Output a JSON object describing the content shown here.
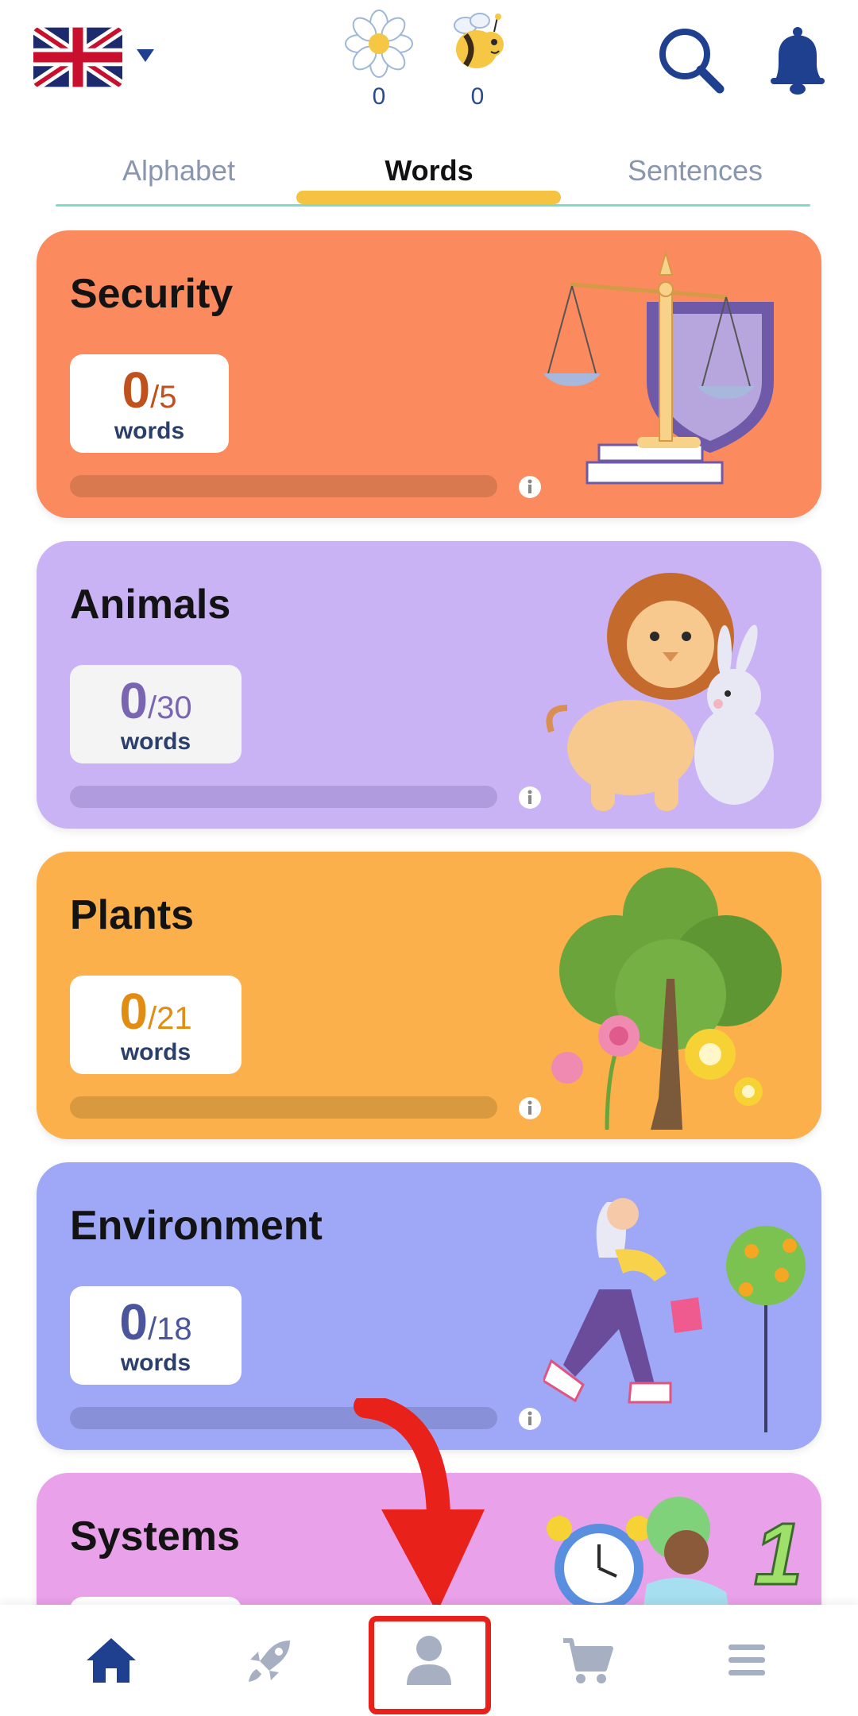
{
  "header": {
    "language_icon": "uk-flag-icon",
    "flower_count": "0",
    "bee_count": "0"
  },
  "tabs": [
    {
      "label": "Alphabet",
      "active": false
    },
    {
      "label": "Words",
      "active": true
    },
    {
      "label": "Sentences",
      "active": false
    }
  ],
  "cards": [
    {
      "title": "Security",
      "done": "0",
      "total": "/5",
      "unit": "words",
      "bg": "#fb8b5f",
      "box_bg": "#ffffff",
      "num_color": "#c0501c",
      "bar_color": "#d9794f",
      "progress": 0
    },
    {
      "title": "Animals",
      "done": "0",
      "total": "/30",
      "unit": "words",
      "bg": "#c9b3f4",
      "box_bg": "#f4f4f4",
      "num_color": "#7a65b3",
      "bar_color": "#b09bde",
      "progress": 0
    },
    {
      "title": "Plants",
      "done": "0",
      "total": "/21",
      "unit": "words",
      "bg": "#fbb04b",
      "box_bg": "#ffffff",
      "num_color": "#e18d14",
      "bar_color": "#d9993e",
      "progress": 0
    },
    {
      "title": "Environment",
      "done": "0",
      "total": "/18",
      "unit": "words",
      "bg": "#9ea8f6",
      "box_bg": "#ffffff",
      "num_color": "#4a559e",
      "bar_color": "#8891d8",
      "progress": 0
    },
    {
      "title": "Systems",
      "done": "",
      "total": "",
      "unit": "",
      "bg": "#e9a1e9",
      "box_bg": "#ffffff",
      "num_color": "#9b4a9b",
      "bar_color": "#cf87cf",
      "progress": 0
    }
  ],
  "bottom_nav": [
    {
      "icon": "home-icon",
      "active": true
    },
    {
      "icon": "rocket-icon",
      "active": false
    },
    {
      "icon": "profile-icon",
      "active": false
    },
    {
      "icon": "cart-icon",
      "active": false
    },
    {
      "icon": "menu-icon",
      "active": false
    }
  ],
  "colors": {
    "accent_blue": "#1f3f8f",
    "tab_indicator": "#f5c242",
    "highlight_red": "#e8221b"
  }
}
